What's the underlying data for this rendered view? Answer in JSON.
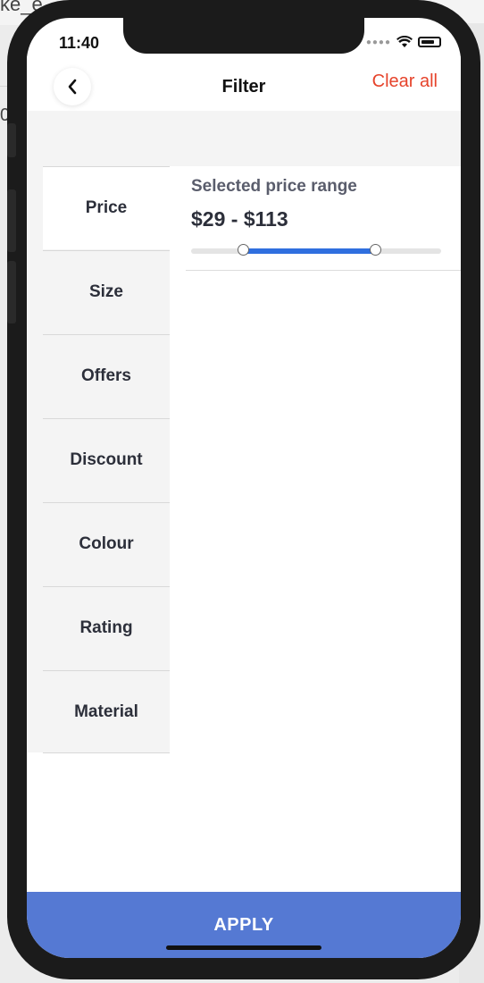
{
  "host": {
    "title_fragment": "ke_e",
    "side_char": "0"
  },
  "status_bar": {
    "time": "11:40"
  },
  "header": {
    "title": "Filter",
    "clear_label": "Clear all"
  },
  "sidebar": {
    "items": [
      {
        "label": "Price",
        "active": true
      },
      {
        "label": "Size",
        "active": false
      },
      {
        "label": "Offers",
        "active": false
      },
      {
        "label": "Discount",
        "active": false
      },
      {
        "label": "Colour",
        "active": false
      },
      {
        "label": "Rating",
        "active": false
      },
      {
        "label": "Material",
        "active": false
      }
    ]
  },
  "price": {
    "label": "Selected price range",
    "value_text": "$29 - $113",
    "selected_min_fraction": 0.21,
    "selected_max_fraction": 0.74
  },
  "footer": {
    "apply_label": "APPLY"
  },
  "colors": {
    "accent_red": "#e6432b",
    "slider_blue": "#2f6fdf",
    "apply_blue": "#5579d3"
  }
}
